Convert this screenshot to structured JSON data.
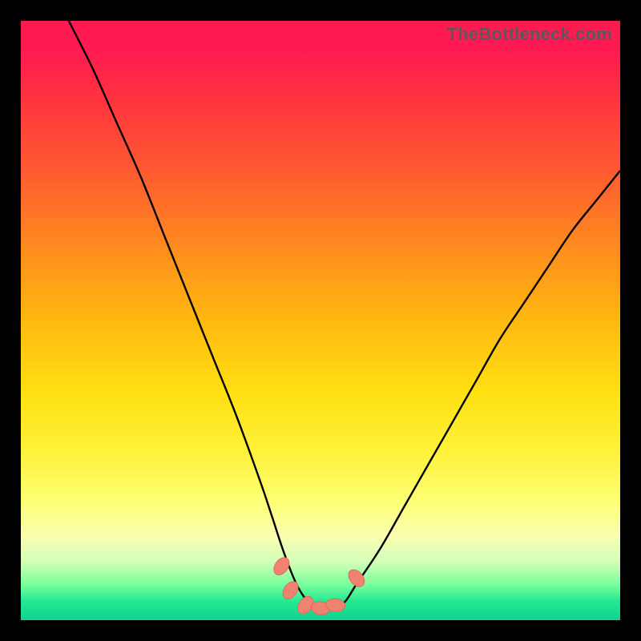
{
  "watermark": "TheBottleneck.com",
  "colors": {
    "frame": "#000000",
    "curve": "#000000",
    "marker_fill": "#f08272",
    "marker_stroke": "#e06a5c",
    "gradient_stops": [
      "#ff1a52",
      "#ff1a52",
      "#ff3040",
      "#ff5a32",
      "#ff8c1e",
      "#ffb80f",
      "#ffe012",
      "#fff23a",
      "#fdff73",
      "#f8ffb0",
      "#d8ffb8",
      "#7bff9d",
      "#20e892",
      "#11d290"
    ]
  },
  "chart_data": {
    "type": "line",
    "title": "",
    "xlabel": "",
    "ylabel": "",
    "xlim": [
      0,
      100
    ],
    "ylim": [
      0,
      100
    ],
    "series": [
      {
        "name": "bottleneck-curve",
        "x": [
          8,
          12,
          16,
          20,
          24,
          28,
          32,
          36,
          40,
          42,
          44,
          46,
          48,
          50,
          52,
          54,
          56,
          60,
          64,
          68,
          72,
          76,
          80,
          84,
          88,
          92,
          96,
          100
        ],
        "y": [
          100,
          92,
          83,
          74,
          64,
          54,
          44,
          34,
          23,
          17,
          11,
          6,
          3,
          2,
          2,
          3,
          6,
          12,
          19,
          26,
          33,
          40,
          47,
          53,
          59,
          65,
          70,
          75
        ]
      }
    ],
    "markers": [
      {
        "name": "left-marker-top",
        "x": 43.5,
        "y": 9.0
      },
      {
        "name": "left-marker-mid",
        "x": 45.0,
        "y": 5.0
      },
      {
        "name": "valley-marker-1",
        "x": 47.5,
        "y": 2.5
      },
      {
        "name": "valley-marker-2",
        "x": 50.0,
        "y": 2.0
      },
      {
        "name": "valley-marker-3",
        "x": 52.5,
        "y": 2.5
      },
      {
        "name": "right-marker",
        "x": 56.0,
        "y": 7.0
      }
    ],
    "annotations": [
      {
        "text": "TheBottleneck.com",
        "position": "top-right"
      }
    ]
  }
}
